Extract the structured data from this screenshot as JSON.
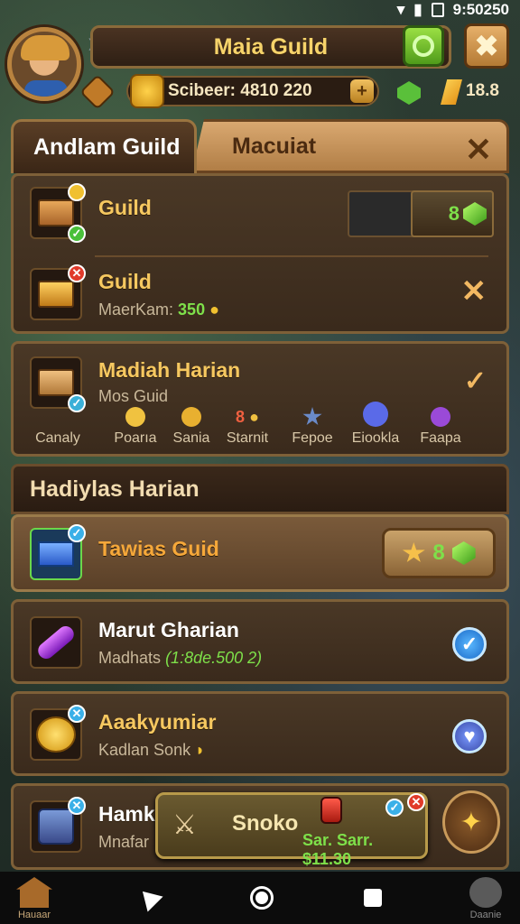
{
  "status": {
    "time": "9:50250"
  },
  "header": {
    "title": "Maia Guild",
    "currency_text": "Scibeer: 4810 220",
    "crystal_value": "18.8"
  },
  "tabs": [
    {
      "label": "Andlam Guild"
    },
    {
      "label": "Macuiat"
    }
  ],
  "guild_rows": [
    {
      "title": "Guild",
      "reward_value": "8"
    },
    {
      "title": "Guild",
      "sub_label": "MaerKam:",
      "sub_value": "350"
    }
  ],
  "daily": {
    "title": "Madiah Harian",
    "subtitle": "Mos Guid",
    "rewards": [
      {
        "label": "Canaly",
        "color": "#e9c24a"
      },
      {
        "label": "Poarıa",
        "color": "#f0c240"
      },
      {
        "label": "Sania",
        "color": "#e8b030"
      },
      {
        "label": "Starnit",
        "color": "#f0a040"
      },
      {
        "label": "Fepoe",
        "color": "#6a8ac8"
      },
      {
        "label": "Eiookla",
        "color": "#5a6ae8"
      },
      {
        "label": "Faapa",
        "color": "#9a4ad8"
      }
    ],
    "starnit_prefix": "8"
  },
  "section": {
    "title": "Hadiylas Harian"
  },
  "quests": [
    {
      "title": "Tawias Guid",
      "reward_value": "8"
    },
    {
      "title": "Marut Gharian",
      "sub_label": "Madhats",
      "sub_value": "(1:8de.500 2)"
    },
    {
      "title": "Aaakyumiar",
      "sub_label": "Kadlan Sonk"
    },
    {
      "title": "Hamks",
      "sub_label": "Mnafar"
    }
  ],
  "popup": {
    "title": "Snoko",
    "sub": "Sar. Sarr. $11.30"
  },
  "bottom": {
    "left_label": "Hauaar",
    "right_label": "Daanie"
  }
}
